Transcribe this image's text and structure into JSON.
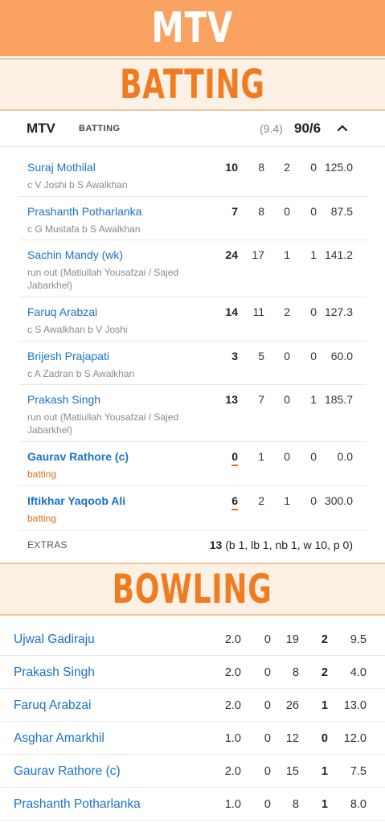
{
  "banner": {
    "title": "MTV"
  },
  "batting_heading": "BATTING",
  "bowling_heading": "BOWLING",
  "innings": {
    "team": "MTV",
    "state": "BATTING",
    "overs": "(9.4)",
    "score": "90/6",
    "toggle_icon": "chevron-up-icon"
  },
  "batting": [
    {
      "name": "Suraj Mothilal",
      "dismissal": "c V Joshi b S Awalkhan",
      "runs": "10",
      "balls": "8",
      "fours": "2",
      "sixes": "0",
      "sr": "125.0"
    },
    {
      "name": "Prashanth Potharlanka",
      "dismissal": "c G Mustafa b S Awalkhan",
      "runs": "7",
      "balls": "8",
      "fours": "0",
      "sixes": "0",
      "sr": "87.5"
    },
    {
      "name": "Sachin Mandy (wk)",
      "dismissal": "run out (Matiullah Yousafzai / Sajed Jabarkhel)",
      "runs": "24",
      "balls": "17",
      "fours": "1",
      "sixes": "1",
      "sr": "141.2"
    },
    {
      "name": "Faruq Arabzai",
      "dismissal": "c S Awalkhan b V Joshi",
      "runs": "14",
      "balls": "11",
      "fours": "2",
      "sixes": "0",
      "sr": "127.3"
    },
    {
      "name": "Brijesh Prajapati",
      "dismissal": "c A Zadran b S Awalkhan",
      "runs": "3",
      "balls": "5",
      "fours": "0",
      "sixes": "0",
      "sr": "60.0"
    },
    {
      "name": "Prakash Singh",
      "dismissal": "run out (Matiullah Yousafzai / Sajed Jabarkhel)",
      "runs": "13",
      "balls": "7",
      "fours": "0",
      "sixes": "1",
      "sr": "185.7"
    },
    {
      "name": "Gaurav Rathore (c)",
      "dismissal": "batting",
      "runs": "0",
      "balls": "1",
      "fours": "0",
      "sixes": "0",
      "sr": "0.0"
    },
    {
      "name": "Iftikhar Yaqoob Ali",
      "dismissal": "batting",
      "runs": "6",
      "balls": "2",
      "fours": "1",
      "sixes": "0",
      "sr": "300.0"
    }
  ],
  "extras": {
    "label": "EXTRAS",
    "total": "13",
    "detail": "(b 1, lb 1, nb 1, w 10, p 0)"
  },
  "bowling": [
    {
      "name": "Ujwal Gadiraju",
      "overs": "2.0",
      "maidens": "0",
      "runs": "19",
      "wickets": "2",
      "economy": "9.5"
    },
    {
      "name": "Prakash Singh",
      "overs": "2.0",
      "maidens": "0",
      "runs": "8",
      "wickets": "2",
      "economy": "4.0"
    },
    {
      "name": "Faruq Arabzai",
      "overs": "2.0",
      "maidens": "0",
      "runs": "26",
      "wickets": "1",
      "economy": "13.0"
    },
    {
      "name": "Asghar Amarkhil",
      "overs": "1.0",
      "maidens": "0",
      "runs": "12",
      "wickets": "0",
      "economy": "12.0"
    },
    {
      "name": "Gaurav Rathore (c)",
      "overs": "2.0",
      "maidens": "0",
      "runs": "15",
      "wickets": "1",
      "economy": "7.5"
    },
    {
      "name": "Prashanth Potharlanka",
      "overs": "1.0",
      "maidens": "0",
      "runs": "8",
      "wickets": "1",
      "economy": "8.0"
    }
  ],
  "colors": {
    "banner": "#f9a261",
    "heading": "#f07c22",
    "link": "#1a73c8",
    "batting_status": "#e0701e"
  }
}
